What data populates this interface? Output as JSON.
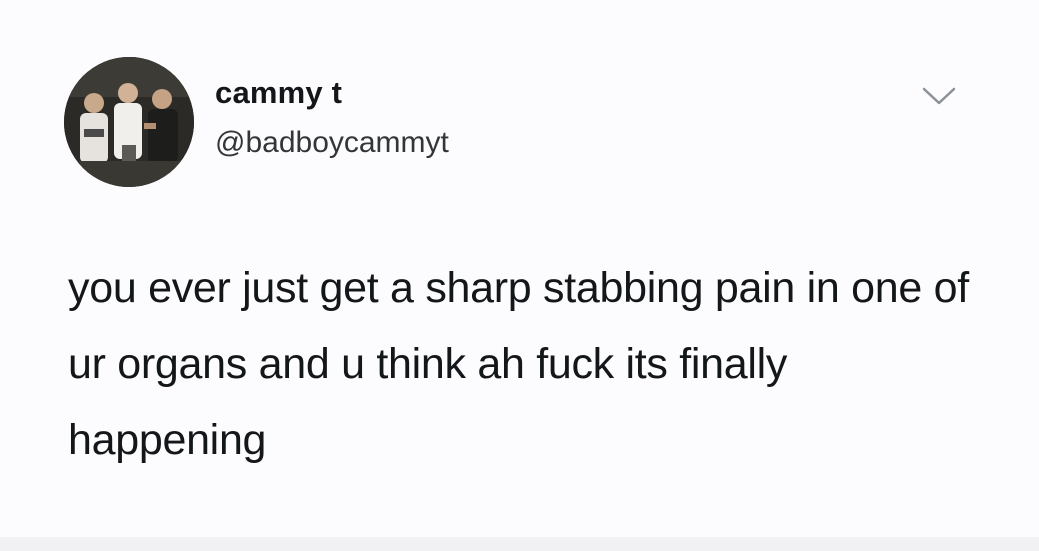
{
  "tweet": {
    "author": {
      "display_name": "cammy t",
      "handle": "@badboycammyt",
      "avatar_icon": "group-photo-avatar"
    },
    "menu_icon": "chevron-down-icon",
    "text": "you ever just get a sharp stabbing pain in one of ur organs and u think ah fuck its finally happening"
  },
  "colors": {
    "background": "#fcfbfd",
    "text": "#14171a",
    "secondary_text": "#333638",
    "chevron": "#8a9199"
  }
}
